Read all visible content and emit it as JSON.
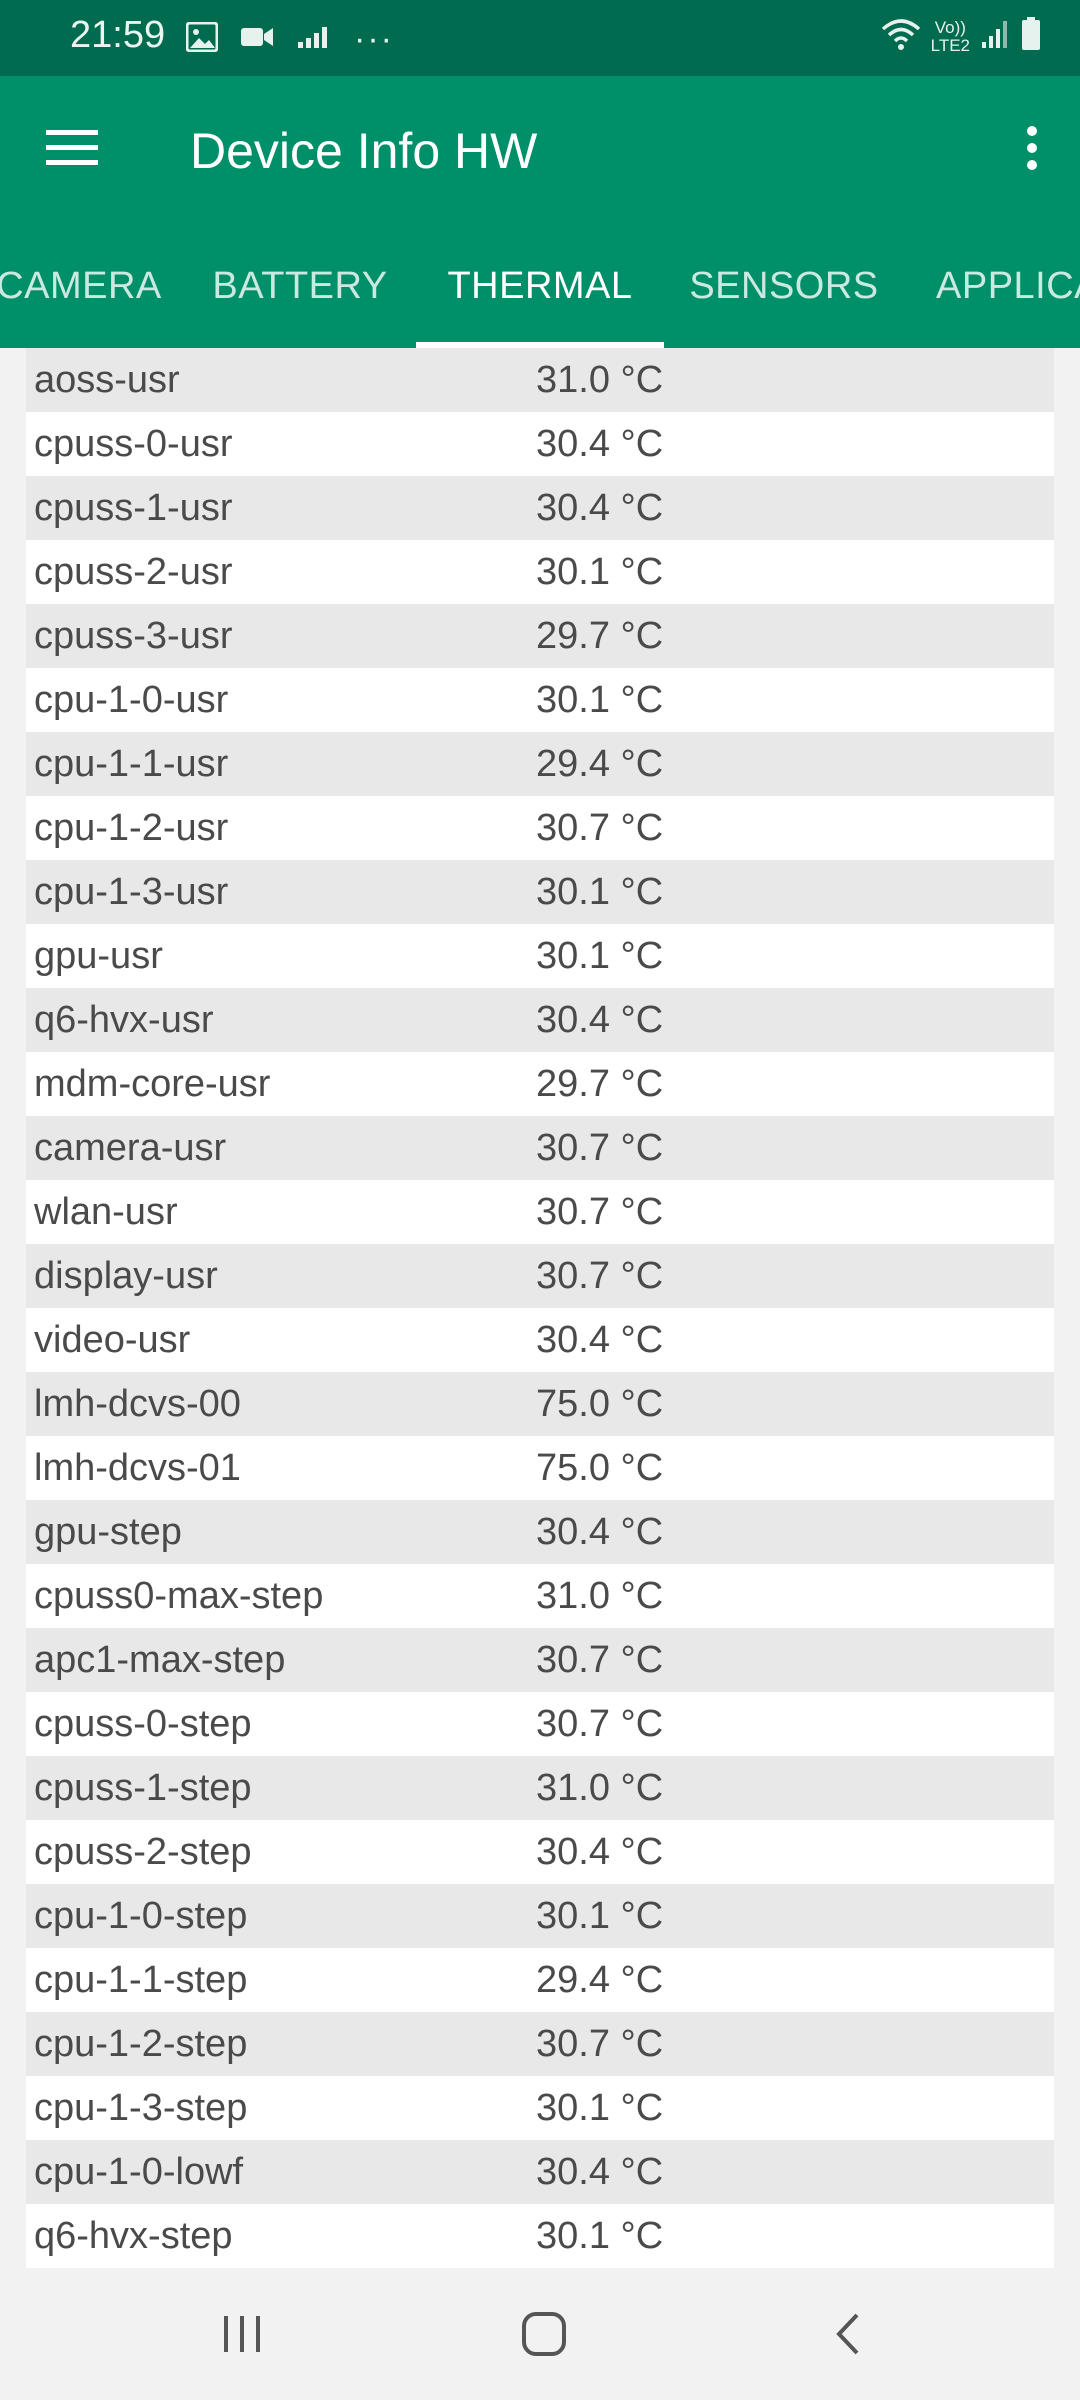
{
  "status_bar": {
    "time": "21:59",
    "left_icons": [
      "image-icon",
      "video-camera-icon",
      "data-usage-icon",
      "more-dots-icon"
    ],
    "right_icons": [
      "wifi-icon",
      "volte-icon",
      "signal-icon",
      "battery-icon"
    ],
    "volte_label_top": "Vo))",
    "volte_label_bottom": "LTE2",
    "more_label": "···"
  },
  "app_bar": {
    "title": "Device Info HW"
  },
  "tabs": [
    {
      "label": "CAMERA",
      "active": false
    },
    {
      "label": "BATTERY",
      "active": false
    },
    {
      "label": "THERMAL",
      "active": true
    },
    {
      "label": "SENSORS",
      "active": false
    },
    {
      "label": "APPLICA",
      "active": false
    }
  ],
  "thermal_rows": [
    {
      "name": "aoss-usr",
      "value": "31.0 °C"
    },
    {
      "name": "cpuss-0-usr",
      "value": "30.4 °C"
    },
    {
      "name": "cpuss-1-usr",
      "value": "30.4 °C"
    },
    {
      "name": "cpuss-2-usr",
      "value": "30.1 °C"
    },
    {
      "name": "cpuss-3-usr",
      "value": "29.7 °C"
    },
    {
      "name": "cpu-1-0-usr",
      "value": "30.1 °C"
    },
    {
      "name": "cpu-1-1-usr",
      "value": "29.4 °C"
    },
    {
      "name": "cpu-1-2-usr",
      "value": "30.7 °C"
    },
    {
      "name": "cpu-1-3-usr",
      "value": "30.1 °C"
    },
    {
      "name": "gpu-usr",
      "value": "30.1 °C"
    },
    {
      "name": "q6-hvx-usr",
      "value": "30.4 °C"
    },
    {
      "name": "mdm-core-usr",
      "value": "29.7 °C"
    },
    {
      "name": "camera-usr",
      "value": "30.7 °C"
    },
    {
      "name": "wlan-usr",
      "value": "30.7 °C"
    },
    {
      "name": "display-usr",
      "value": "30.7 °C"
    },
    {
      "name": "video-usr",
      "value": "30.4 °C"
    },
    {
      "name": "lmh-dcvs-00",
      "value": "75.0 °C"
    },
    {
      "name": "lmh-dcvs-01",
      "value": "75.0 °C"
    },
    {
      "name": "gpu-step",
      "value": "30.4 °C"
    },
    {
      "name": "cpuss0-max-step",
      "value": "31.0 °C"
    },
    {
      "name": "apc1-max-step",
      "value": "30.7 °C"
    },
    {
      "name": "cpuss-0-step",
      "value": "30.7 °C"
    },
    {
      "name": "cpuss-1-step",
      "value": "31.0 °C"
    },
    {
      "name": "cpuss-2-step",
      "value": "30.4 °C"
    },
    {
      "name": "cpu-1-0-step",
      "value": "30.1 °C"
    },
    {
      "name": "cpu-1-1-step",
      "value": "29.4 °C"
    },
    {
      "name": "cpu-1-2-step",
      "value": "30.7 °C"
    },
    {
      "name": "cpu-1-3-step",
      "value": "30.1 °C"
    },
    {
      "name": "cpu-1-0-lowf",
      "value": "30.4 °C"
    },
    {
      "name": "q6-hvx-step",
      "value": "30.1 °C"
    }
  ],
  "nav_bar": {
    "buttons": [
      "recent-apps-icon",
      "home-icon",
      "back-icon"
    ]
  },
  "colors": {
    "status_bar": "#006b4f",
    "primary": "#009069",
    "row_stripe": "#e8e8e8",
    "text": "#4a4a4a"
  }
}
